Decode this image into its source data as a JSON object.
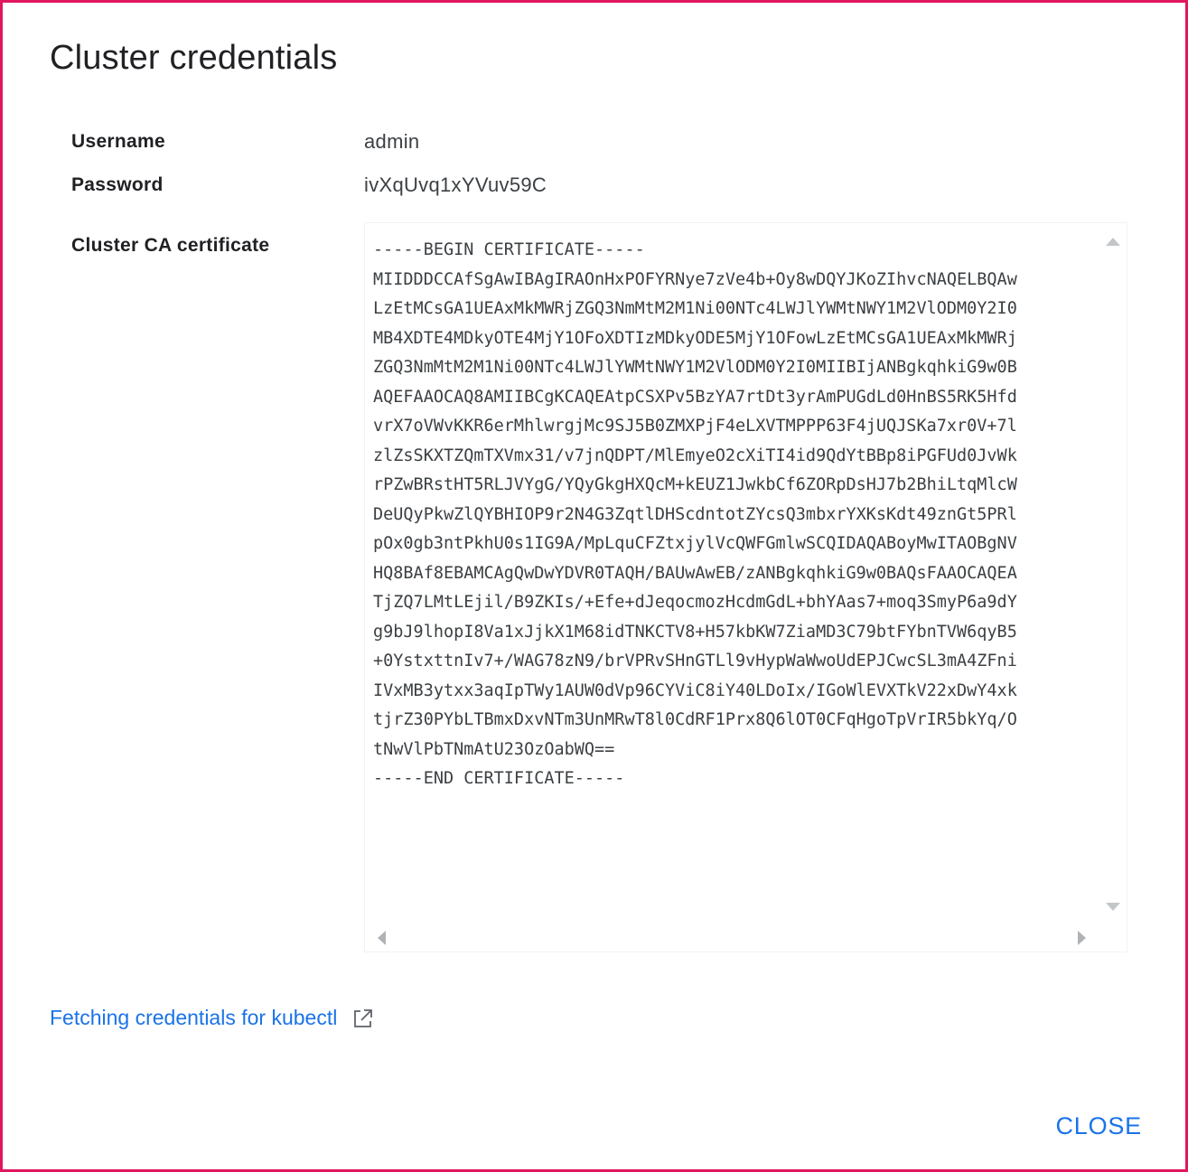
{
  "dialog": {
    "title": "Cluster credentials"
  },
  "fields": {
    "username_label": "Username",
    "username_value": "admin",
    "password_label": "Password",
    "password_value": "ivXqUvq1xYVuv59C",
    "ca_label": "Cluster CA certificate",
    "ca_value": "-----BEGIN CERTIFICATE-----\nMIIDDDCCAfSgAwIBAgIRAOnHxPOFYRNye7zVe4b+Oy8wDQYJKoZIhvcNAQELBQAw\nLzEtMCsGA1UEAxMkMWRjZGQ3NmMtM2M1Ni00NTc4LWJlYWMtNWY1M2VlODM0Y2I0\nMB4XDTE4MDkyOTE4MjY1OFoXDTIzMDkyODE5MjY1OFowLzEtMCsGA1UEAxMkMWRj\nZGQ3NmMtM2M1Ni00NTc4LWJlYWMtNWY1M2VlODM0Y2I0MIIBIjANBgkqhkiG9w0B\nAQEFAAOCAQ8AMIIBCgKCAQEAtpCSXPv5BzYA7rtDt3yrAmPUGdLd0HnBS5RK5Hfd\nvrX7oVWvKKR6erMhlwrgjMc9SJ5B0ZMXPjF4eLXVTMPPP63F4jUQJSKa7xr0V+7l\nzlZsSKXTZQmTXVmx31/v7jnQDPT/MlEmyeO2cXiTI4id9QdYtBBp8iPGFUd0JvWk\nrPZwBRstHT5RLJVYgG/YQyGkgHXQcM+kEUZ1JwkbCf6ZORpDsHJ7b2BhiLtqMlcW\nDeUQyPkwZlQYBHIOP9r2N4G3ZqtlDHScdntotZYcsQ3mbxrYXKsKdt49znGt5PRl\npOx0gb3ntPkhU0s1IG9A/MpLquCFZtxjylVcQWFGmlwSCQIDAQABoyMwITAOBgNV\nHQ8BAf8EBAMCAgQwDwYDVR0TAQH/BAUwAwEB/zANBgkqhkiG9w0BAQsFAAOCAQEA\nTjZQ7LMtLEjil/B9ZKIs/+Efe+dJeqocmozHcdmGdL+bhYAas7+moq3SmyP6a9dY\ng9bJ9lhopI8Va1xJjkX1M68idTNKCTV8+H57kbKW7ZiaMD3C79btFYbnTVW6qyB5\n+0YstxttnIv7+/WAG78zN9/brVPRvSHnGTLl9vHypWaWwoUdEPJCwcSL3mA4ZFni\nIVxMB3ytxx3aqIpTWy1AUW0dVp96CYViC8iY40LDoIx/IGoWlEVXTkV22xDwY4xk\ntjrZ30PYbLTBmxDxvNTm3UnMRwT8l0CdRF1Prx8Q6lOT0CFqHgoTpVrIR5bkYq/O\ntNwVlPbTNmAtU23OzOabWQ==\n-----END CERTIFICATE-----"
  },
  "footer": {
    "help_link_label": "Fetching credentials for kubectl",
    "help_link_icon": "external-link-icon",
    "close_label": "CLOSE"
  },
  "colors": {
    "frame_border": "#e0175f",
    "link": "#1a73e8",
    "text": "#202124"
  }
}
